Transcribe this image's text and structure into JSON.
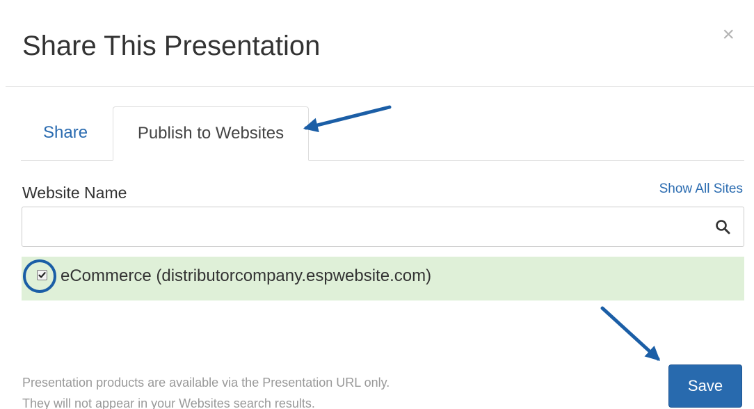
{
  "dialog": {
    "title": "Share This Presentation",
    "close_glyph": "×"
  },
  "tabs": [
    {
      "label": "Share",
      "active": false
    },
    {
      "label": "Publish to Websites",
      "active": true
    }
  ],
  "website_field": {
    "label": "Website Name",
    "show_all_link": "Show All Sites",
    "value": "",
    "placeholder": ""
  },
  "sites": [
    {
      "label": "eCommerce (distributorcompany.espwebsite.com)",
      "checked": true
    }
  ],
  "footer": {
    "note_line1": "Presentation products are available via the Presentation URL only.",
    "note_line2": "They will not appear in your Websites search results.",
    "save_label": "Save"
  },
  "colors": {
    "link": "#2a6bb0",
    "selected_row": "#dff0d8",
    "primary_button": "#286aae",
    "annotation": "#1b5ea6"
  },
  "icons": {
    "close": "close-icon",
    "search": "search-icon",
    "checkbox": "checkmark-icon"
  }
}
